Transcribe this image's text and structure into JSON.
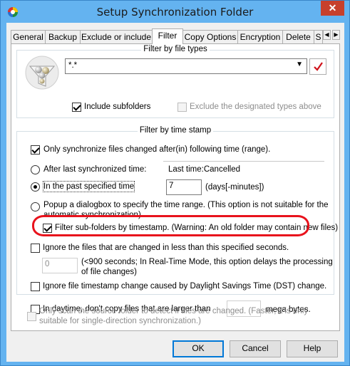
{
  "window": {
    "title": "Setup Synchronization Folder",
    "close_glyph": "✕"
  },
  "tabs": [
    {
      "label": "General"
    },
    {
      "label": "Backup"
    },
    {
      "label": "Exclude or include"
    },
    {
      "label": "Filter"
    },
    {
      "label": "Copy Options"
    },
    {
      "label": "Encryption"
    },
    {
      "label": "Delete"
    },
    {
      "label": "S"
    }
  ],
  "active_tab": "Filter",
  "filetypes": {
    "legend": "Filter by file types",
    "pattern": "*.*",
    "include_subfolders": "Include subfolders",
    "exclude_designated": "Exclude the designated types above"
  },
  "timestamp": {
    "legend": "Filter by time stamp",
    "only_sync_changed": "Only synchronize files changed after(in) following time (range).",
    "after_last_sync": "After last synchronized time:",
    "last_time_status": "Last time:Cancelled",
    "in_past_time": "In the past specified time",
    "days_value": "7",
    "days_unit": "(days[-minutes])",
    "popup_dialog": "Popup a dialogbox to specify the time range. (This option is not suitable for the automatic synchronization)",
    "filter_subfolders": "Filter sub-folders by timestamp. (Warning: An old folder may contain new files)"
  },
  "ignore_recent": {
    "label": "Ignore the files that are changed in less than this specified seconds.",
    "value": "0",
    "note": "(<900 seconds; In Real-Time Mode, this option delays the processing of file changes)"
  },
  "ignore_dst": "Ignore file timestamp change caused by Daylight Savings Time (DST) change.",
  "daytime_limit": {
    "label": "In daytime, don't copy files that are larger than",
    "value": "",
    "unit": "mega bytes."
  },
  "only_scan_source": "Only scan the source folder to detect if files are changed. (Faster, it is only suitable for single-direction synchronization.)",
  "buttons": {
    "ok": "OK",
    "cancel": "Cancel",
    "help": "Help"
  },
  "colors": {
    "title_bar": "#64b3f0",
    "close_button": "#c7402c",
    "highlight_ellipse": "#e8121c",
    "check_button_mark": "#d0121a"
  },
  "icons": [
    "app-icon",
    "close-icon",
    "tab-scroll-left-icon",
    "tab-scroll-right-icon",
    "filter-balls-icon",
    "dropdown-arrow-icon",
    "checkmark-icon"
  ]
}
